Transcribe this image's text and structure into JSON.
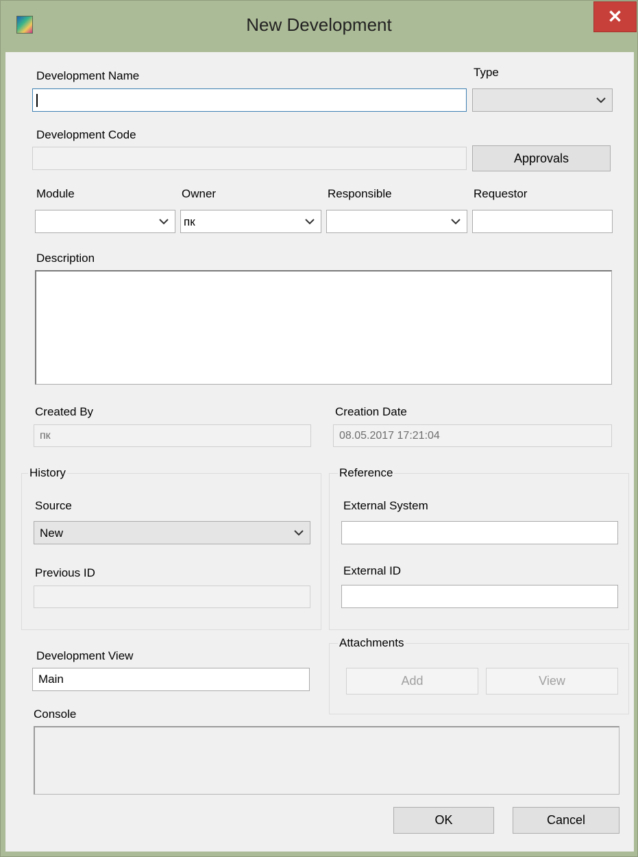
{
  "window": {
    "title": "New Development",
    "close_glyph": "✕",
    "icon": "app-icon"
  },
  "fields": {
    "development_name": {
      "label": "Development Name",
      "value": ""
    },
    "type": {
      "label": "Type",
      "value": ""
    },
    "development_code": {
      "label": "Development Code",
      "value": ""
    },
    "approvals_button": "Approvals",
    "module": {
      "label": "Module",
      "value": ""
    },
    "owner": {
      "label": "Owner",
      "value": "пк"
    },
    "responsible": {
      "label": "Responsible",
      "value": ""
    },
    "requestor": {
      "label": "Requestor",
      "value": ""
    },
    "description": {
      "label": "Description",
      "value": ""
    },
    "created_by": {
      "label": "Created By",
      "value": "пк"
    },
    "creation_date": {
      "label": "Creation Date",
      "value": "08.05.2017 17:21:04"
    }
  },
  "history": {
    "group_label": "History",
    "source": {
      "label": "Source",
      "value": "New"
    },
    "previous_id": {
      "label": "Previous ID",
      "value": ""
    }
  },
  "reference": {
    "group_label": "Reference",
    "external_system": {
      "label": "External System",
      "value": ""
    },
    "external_id": {
      "label": "External ID",
      "value": ""
    }
  },
  "development_view": {
    "label": "Development View",
    "value": "Main"
  },
  "attachments": {
    "group_label": "Attachments",
    "add_label": "Add",
    "view_label": "View"
  },
  "console": {
    "label": "Console",
    "value": ""
  },
  "buttons": {
    "ok": "OK",
    "cancel": "Cancel"
  },
  "colors": {
    "title_bar": "#acbb97",
    "close_button": "#c7403a",
    "dialog_bg": "#f0f0f0",
    "focus_border": "#3c7fb1"
  }
}
